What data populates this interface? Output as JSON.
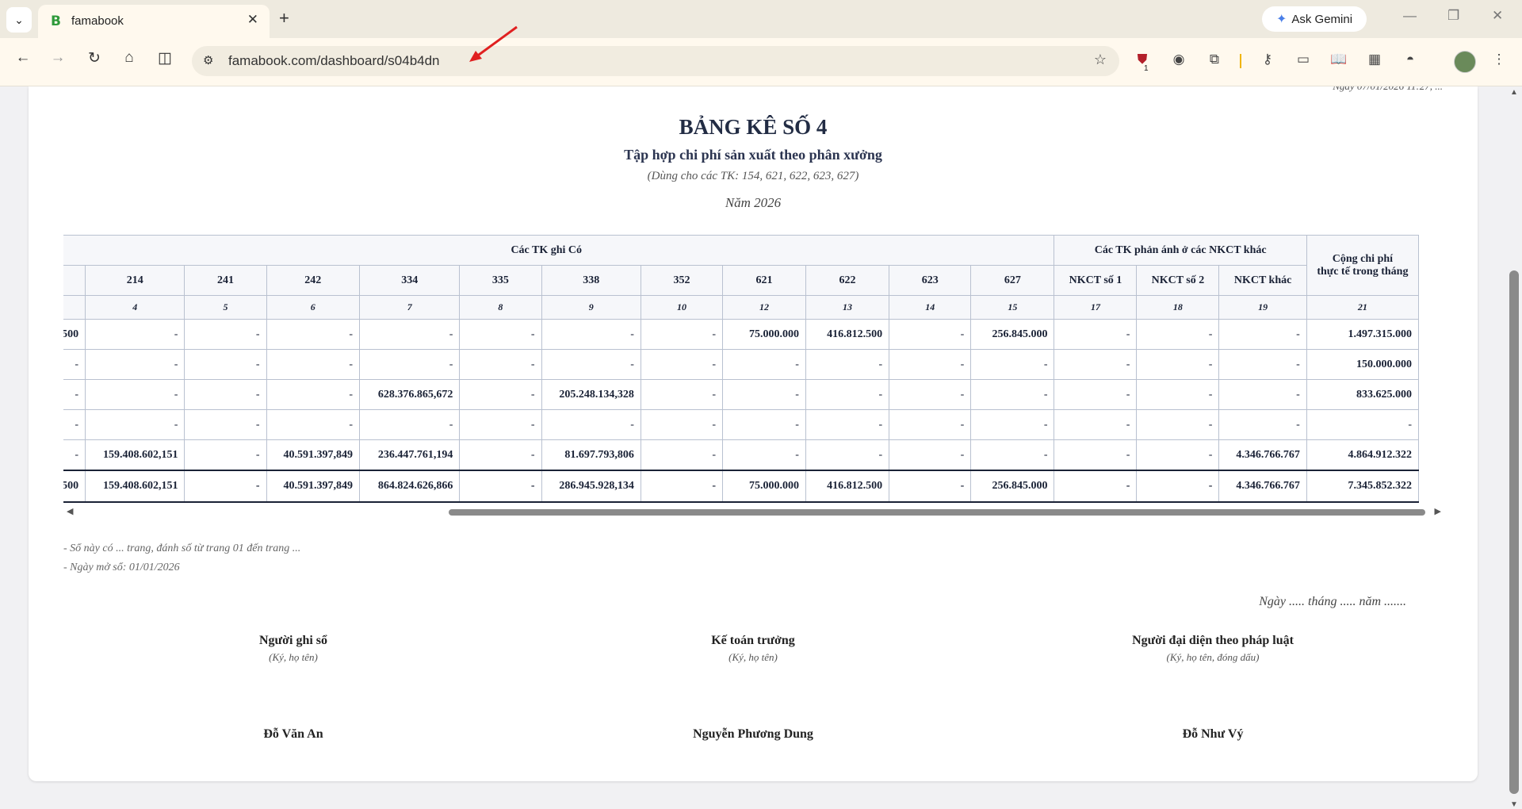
{
  "browser": {
    "tab_title": "famabook",
    "tab_favicon": "B",
    "new_tab": "+",
    "ask_gemini": "Ask Gemini",
    "url": "famabook.com/dashboard/s04b4dn",
    "extension_badge": "1"
  },
  "report": {
    "clipped_top_text": "Ngày 07/01/2026 11:27, ...",
    "title": "BẢNG KÊ SỐ 4",
    "subtitle": "Tập hợp chi phí sản xuất theo phân xưởng",
    "scope": "(Dùng cho các TK: 154, 621, 622, 623, 627)",
    "year": "Năm 2026"
  },
  "table": {
    "group_credit": "Các TK ghi Có",
    "group_other": "Các TK phản ánh ở các NKCT khác",
    "total_header_line1": "Cộng chi phí",
    "total_header_line2": "thực tế trong tháng",
    "columns": [
      "214",
      "241",
      "242",
      "334",
      "335",
      "338",
      "352",
      "621",
      "622",
      "623",
      "627",
      "NKCT số 1",
      "NKCT số 2",
      "NKCT khác"
    ],
    "col_numbers": [
      "",
      "4",
      "5",
      "6",
      "7",
      "8",
      "9",
      "10",
      "12",
      "13",
      "14",
      "15",
      "17",
      "18",
      "19",
      "21"
    ],
    "rows": [
      [
        "500",
        "-",
        "-",
        "-",
        "-",
        "-",
        "-",
        "-",
        "75.000.000",
        "416.812.500",
        "-",
        "256.845.000",
        "-",
        "-",
        "-",
        "1.497.315.000"
      ],
      [
        "-",
        "-",
        "-",
        "-",
        "-",
        "-",
        "-",
        "-",
        "-",
        "-",
        "-",
        "-",
        "-",
        "-",
        "-",
        "150.000.000"
      ],
      [
        "-",
        "-",
        "-",
        "-",
        "628.376.865,672",
        "-",
        "205.248.134,328",
        "-",
        "-",
        "-",
        "-",
        "-",
        "-",
        "-",
        "-",
        "833.625.000"
      ],
      [
        "-",
        "-",
        "-",
        "-",
        "-",
        "-",
        "-",
        "-",
        "-",
        "-",
        "-",
        "-",
        "-",
        "-",
        "-",
        "-"
      ],
      [
        "-",
        "159.408.602,151",
        "-",
        "40.591.397,849",
        "236.447.761,194",
        "-",
        "81.697.793,806",
        "-",
        "-",
        "-",
        "-",
        "-",
        "-",
        "-",
        "4.346.766.767",
        "4.864.912.322"
      ]
    ],
    "total": [
      "500",
      "159.408.602,151",
      "-",
      "40.591.397,849",
      "864.824.626,866",
      "-",
      "286.945.928,134",
      "-",
      "75.000.000",
      "416.812.500",
      "-",
      "256.845.000",
      "-",
      "-",
      "4.346.766.767",
      "7.345.852.322"
    ]
  },
  "notes": {
    "pages": "- Sổ này có ... trang, đánh số từ trang 01 đến trang ...",
    "open_date": "- Ngày mở sổ: 01/01/2026",
    "date_line": "Ngày ..... tháng ..... năm ......."
  },
  "signatures": [
    {
      "role": "Người ghi sổ",
      "hint": "(Ký, họ tên)",
      "name": "Đỗ Văn An"
    },
    {
      "role": "Kế toán trưởng",
      "hint": "(Ký, họ tên)",
      "name": "Nguyễn Phương Dung"
    },
    {
      "role": "Người đại diện theo pháp luật",
      "hint": "(Ký, họ tên, đóng dấu)",
      "name": "Đỗ Như Vý"
    }
  ]
}
